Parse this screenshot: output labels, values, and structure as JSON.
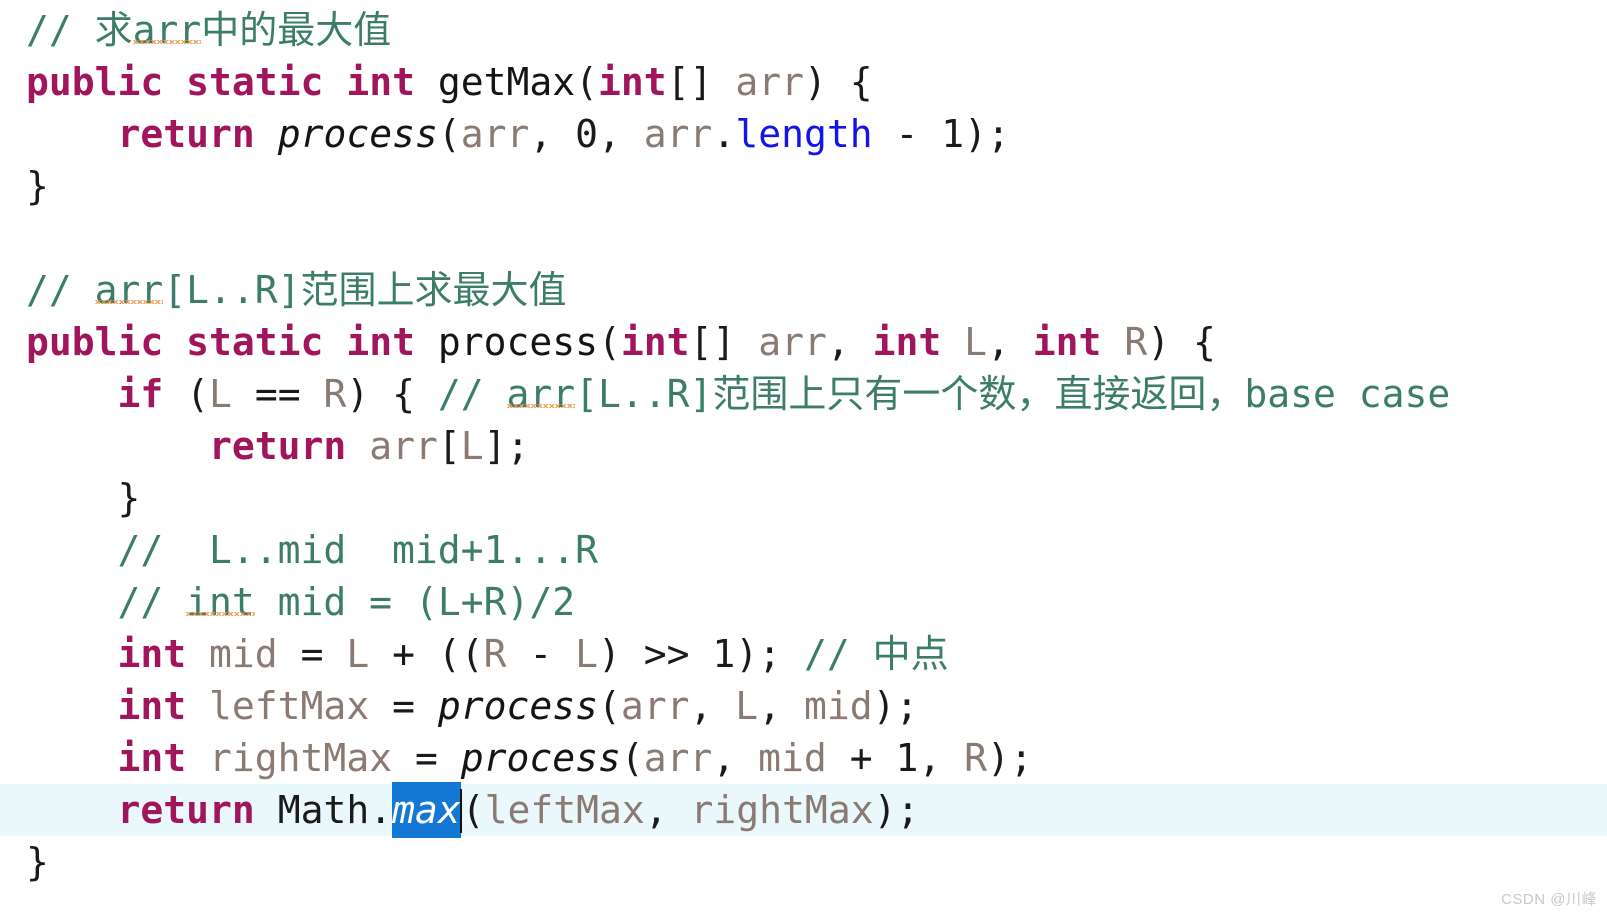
{
  "editor": {
    "language": "java",
    "background_color": "#ffffff",
    "current_line_highlight_color": "#eaf7fb",
    "selection_color": "#1378d4",
    "colors": {
      "keyword": "#a0155c",
      "comment": "#3c7d69",
      "identifier": "#8a7a72",
      "field": "#1414e6",
      "plain": "#1a1a1a",
      "spellcheck_squiggle": "#e8964a"
    }
  },
  "lines": [
    {
      "n": 1,
      "text": "// 求arr中的最大值",
      "tokens": [
        {
          "t": "// ",
          "c": "cmt"
        },
        {
          "t": "求",
          "c": "cmt"
        },
        {
          "t": "arr",
          "c": "cmt squig"
        },
        {
          "t": "中的最大值",
          "c": "cmt"
        }
      ]
    },
    {
      "n": 2,
      "text": "public static int getMax(int[] arr) {",
      "tokens": [
        {
          "t": "public",
          "c": "kw"
        },
        {
          "t": " ",
          "c": "plain"
        },
        {
          "t": "static",
          "c": "kw"
        },
        {
          "t": " ",
          "c": "plain"
        },
        {
          "t": "int",
          "c": "kw"
        },
        {
          "t": " ",
          "c": "plain"
        },
        {
          "t": "getMax",
          "c": "mdecl"
        },
        {
          "t": "(",
          "c": "punct"
        },
        {
          "t": "int",
          "c": "kw"
        },
        {
          "t": "[] ",
          "c": "punct"
        },
        {
          "t": "arr",
          "c": "ident"
        },
        {
          "t": ") {",
          "c": "punct"
        }
      ]
    },
    {
      "n": 3,
      "text": "    return process(arr, 0, arr.length - 1);",
      "tokens": [
        {
          "t": "    ",
          "c": "plain"
        },
        {
          "t": "return",
          "c": "kw"
        },
        {
          "t": " ",
          "c": "plain"
        },
        {
          "t": "process",
          "c": "mcall"
        },
        {
          "t": "(",
          "c": "punct"
        },
        {
          "t": "arr",
          "c": "ident"
        },
        {
          "t": ", ",
          "c": "punct"
        },
        {
          "t": "0",
          "c": "num"
        },
        {
          "t": ", ",
          "c": "punct"
        },
        {
          "t": "arr",
          "c": "ident"
        },
        {
          "t": ".",
          "c": "punct"
        },
        {
          "t": "length",
          "c": "fld"
        },
        {
          "t": " - ",
          "c": "punct"
        },
        {
          "t": "1",
          "c": "num"
        },
        {
          "t": ");",
          "c": "punct"
        }
      ]
    },
    {
      "n": 4,
      "text": "}",
      "tokens": [
        {
          "t": "}",
          "c": "plain"
        }
      ]
    },
    {
      "n": 5,
      "text": "",
      "tokens": [
        {
          "t": " ",
          "c": "plain"
        }
      ]
    },
    {
      "n": 6,
      "text": "// arr[L..R]范围上求最大值",
      "tokens": [
        {
          "t": "// ",
          "c": "cmt"
        },
        {
          "t": "arr",
          "c": "cmt squig"
        },
        {
          "t": "[L..R]范围上求最大值",
          "c": "cmt"
        }
      ]
    },
    {
      "n": 7,
      "text": "public static int process(int[] arr, int L, int R) {",
      "tokens": [
        {
          "t": "public",
          "c": "kw"
        },
        {
          "t": " ",
          "c": "plain"
        },
        {
          "t": "static",
          "c": "kw"
        },
        {
          "t": " ",
          "c": "plain"
        },
        {
          "t": "int",
          "c": "kw"
        },
        {
          "t": " ",
          "c": "plain"
        },
        {
          "t": "process",
          "c": "mdecl"
        },
        {
          "t": "(",
          "c": "punct"
        },
        {
          "t": "int",
          "c": "kw"
        },
        {
          "t": "[] ",
          "c": "punct"
        },
        {
          "t": "arr",
          "c": "ident"
        },
        {
          "t": ", ",
          "c": "punct"
        },
        {
          "t": "int",
          "c": "kw"
        },
        {
          "t": " ",
          "c": "plain"
        },
        {
          "t": "L",
          "c": "ident"
        },
        {
          "t": ", ",
          "c": "punct"
        },
        {
          "t": "int",
          "c": "kw"
        },
        {
          "t": " ",
          "c": "plain"
        },
        {
          "t": "R",
          "c": "ident"
        },
        {
          "t": ") {",
          "c": "punct"
        }
      ]
    },
    {
      "n": 8,
      "text": "    if (L == R) { // arr[L..R]范围上只有一个数，直接返回，base case",
      "tokens": [
        {
          "t": "    ",
          "c": "plain"
        },
        {
          "t": "if",
          "c": "kw"
        },
        {
          "t": " (",
          "c": "punct"
        },
        {
          "t": "L",
          "c": "ident"
        },
        {
          "t": " == ",
          "c": "punct"
        },
        {
          "t": "R",
          "c": "ident"
        },
        {
          "t": ") { ",
          "c": "punct"
        },
        {
          "t": "// ",
          "c": "cmt"
        },
        {
          "t": "arr",
          "c": "cmt squig"
        },
        {
          "t": "[L..R]范围上只有一个数，直接返回，base case",
          "c": "cmt"
        }
      ]
    },
    {
      "n": 9,
      "text": "        return arr[L];",
      "tokens": [
        {
          "t": "        ",
          "c": "plain"
        },
        {
          "t": "return",
          "c": "kw"
        },
        {
          "t": " ",
          "c": "plain"
        },
        {
          "t": "arr",
          "c": "ident"
        },
        {
          "t": "[",
          "c": "punct"
        },
        {
          "t": "L",
          "c": "ident"
        },
        {
          "t": "];",
          "c": "punct"
        }
      ]
    },
    {
      "n": 10,
      "text": "    }",
      "tokens": [
        {
          "t": "    }",
          "c": "plain"
        }
      ]
    },
    {
      "n": 11,
      "text": "    //  L..mid  mid+1...R",
      "tokens": [
        {
          "t": "    ",
          "c": "plain"
        },
        {
          "t": "//  L..mid  mid+1...R",
          "c": "cmt"
        }
      ]
    },
    {
      "n": 12,
      "text": "    // int mid = (L+R)/2",
      "tokens": [
        {
          "t": "    ",
          "c": "plain"
        },
        {
          "t": "// ",
          "c": "cmt"
        },
        {
          "t": "int",
          "c": "cmt squig"
        },
        {
          "t": " mid = (L+R)/2",
          "c": "cmt"
        }
      ]
    },
    {
      "n": 13,
      "text": "    int mid = L + ((R - L) >> 1); // 中点",
      "tokens": [
        {
          "t": "    ",
          "c": "plain"
        },
        {
          "t": "int",
          "c": "kw"
        },
        {
          "t": " ",
          "c": "plain"
        },
        {
          "t": "mid",
          "c": "ident"
        },
        {
          "t": " = ",
          "c": "punct"
        },
        {
          "t": "L",
          "c": "ident"
        },
        {
          "t": " + ((",
          "c": "punct"
        },
        {
          "t": "R",
          "c": "ident"
        },
        {
          "t": " - ",
          "c": "punct"
        },
        {
          "t": "L",
          "c": "ident"
        },
        {
          "t": ") >> ",
          "c": "punct"
        },
        {
          "t": "1",
          "c": "num"
        },
        {
          "t": "); ",
          "c": "punct"
        },
        {
          "t": "// 中点",
          "c": "cmt"
        }
      ]
    },
    {
      "n": 14,
      "text": "    int leftMax = process(arr, L, mid);",
      "tokens": [
        {
          "t": "    ",
          "c": "plain"
        },
        {
          "t": "int",
          "c": "kw"
        },
        {
          "t": " ",
          "c": "plain"
        },
        {
          "t": "leftMax",
          "c": "ident"
        },
        {
          "t": " = ",
          "c": "punct"
        },
        {
          "t": "process",
          "c": "mcall"
        },
        {
          "t": "(",
          "c": "punct"
        },
        {
          "t": "arr",
          "c": "ident"
        },
        {
          "t": ", ",
          "c": "punct"
        },
        {
          "t": "L",
          "c": "ident"
        },
        {
          "t": ", ",
          "c": "punct"
        },
        {
          "t": "mid",
          "c": "ident"
        },
        {
          "t": ");",
          "c": "punct"
        }
      ]
    },
    {
      "n": 15,
      "text": "    int rightMax = process(arr, mid + 1, R);",
      "tokens": [
        {
          "t": "    ",
          "c": "plain"
        },
        {
          "t": "int",
          "c": "kw"
        },
        {
          "t": " ",
          "c": "plain"
        },
        {
          "t": "rightMax",
          "c": "ident"
        },
        {
          "t": " = ",
          "c": "punct"
        },
        {
          "t": "process",
          "c": "mcall"
        },
        {
          "t": "(",
          "c": "punct"
        },
        {
          "t": "arr",
          "c": "ident"
        },
        {
          "t": ", ",
          "c": "punct"
        },
        {
          "t": "mid",
          "c": "ident"
        },
        {
          "t": " + ",
          "c": "punct"
        },
        {
          "t": "1",
          "c": "num"
        },
        {
          "t": ", ",
          "c": "punct"
        },
        {
          "t": "R",
          "c": "ident"
        },
        {
          "t": ");",
          "c": "punct"
        }
      ]
    },
    {
      "n": 16,
      "current": true,
      "text": "    return Math.max(leftMax, rightMax);",
      "tokens": [
        {
          "t": "    ",
          "c": "plain"
        },
        {
          "t": "return",
          "c": "kw"
        },
        {
          "t": " ",
          "c": "plain"
        },
        {
          "t": "Math",
          "c": "plain"
        },
        {
          "t": ".",
          "c": "punct"
        },
        {
          "t": "max",
          "c": "sel"
        },
        {
          "t": "",
          "c": "caret"
        },
        {
          "t": "(",
          "c": "punct"
        },
        {
          "t": "leftMax",
          "c": "ident"
        },
        {
          "t": ", ",
          "c": "punct"
        },
        {
          "t": "rightMax",
          "c": "ident"
        },
        {
          "t": ");",
          "c": "punct"
        }
      ]
    },
    {
      "n": 17,
      "text": "}",
      "tokens": [
        {
          "t": "}",
          "c": "plain"
        }
      ]
    }
  ],
  "selection": {
    "selected_text": "max",
    "line": 16
  },
  "watermark": {
    "text": "CSDN @川峰"
  }
}
